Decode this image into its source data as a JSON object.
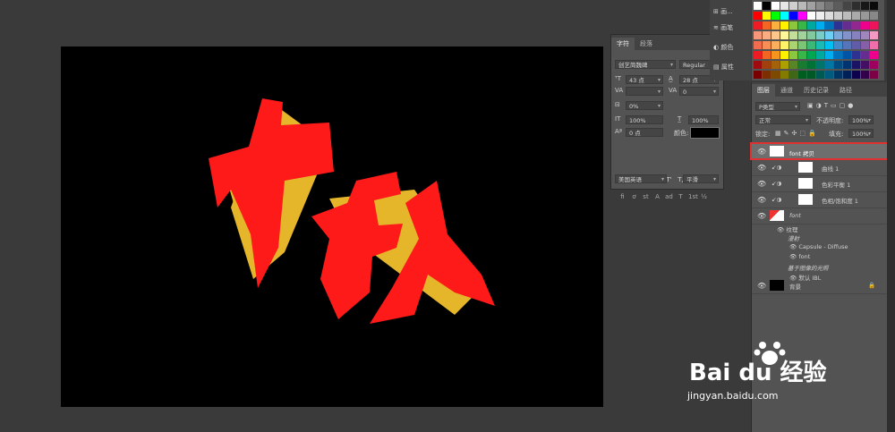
{
  "canvas": {
    "artwork_text": "中秋",
    "colors": {
      "background": "#000000",
      "front": "#ff1a1a",
      "extrude": "#e5b62a"
    }
  },
  "char_panel": {
    "tabs": [
      "字符",
      "段落"
    ],
    "font_family": "创艺简魏碑",
    "font_style": "Regular",
    "font_size": "43 点",
    "leading": "28 点",
    "tracking": "0",
    "scale_pct": "0%",
    "vert_scale": "100%",
    "horiz_scale": "100%",
    "baseline": "0 点",
    "color_label": "颜色:",
    "language": "美国英语",
    "antialias": "平滑",
    "style_buttons": [
      "T",
      "T",
      "TT",
      "Tт",
      "T'",
      "T,",
      "T",
      "T"
    ],
    "ot_buttons": [
      "fi",
      "ơ",
      "st",
      "A",
      "ad",
      "T",
      "1st",
      "½"
    ]
  },
  "dock": {
    "items": [
      "画...",
      "画笔",
      "颜色",
      "属性"
    ]
  },
  "swatches": {
    "rows": [
      [
        "#ffffff",
        "#000000",
        "#ffffff",
        "#e6e6e6",
        "#cfcfcf",
        "#b8b8b8",
        "#a1a1a1",
        "#8a8a8a",
        "#737373",
        "#5c5c5c",
        "#454545",
        "#2e2e2e",
        "#171717",
        "#0a0a0a"
      ],
      [
        "#ff0000",
        "#ffff00",
        "#00ff00",
        "#00ffff",
        "#0000ff",
        "#ff00ff",
        "#ffffff",
        "#eeeeee",
        "#dddddd",
        "#cccccc",
        "#bbbbbb",
        "#aaaaaa",
        "#999999",
        "#888888"
      ],
      [
        "#ee1c24",
        "#f26522",
        "#fbaf3f",
        "#fff200",
        "#8dc63f",
        "#39b54a",
        "#00a99d",
        "#00aeef",
        "#0072bc",
        "#2e3192",
        "#662d91",
        "#92278f",
        "#ec008c",
        "#ed145b"
      ],
      [
        "#f7977a",
        "#f9ad81",
        "#fdc68a",
        "#fff79a",
        "#c4df9b",
        "#a3d39c",
        "#82ca9d",
        "#7accc8",
        "#6dcff6",
        "#7da7d9",
        "#8393ca",
        "#8781bd",
        "#a186be",
        "#f49ac2"
      ],
      [
        "#f26c4f",
        "#f68e55",
        "#fbaf5c",
        "#fff467",
        "#acd372",
        "#7cc576",
        "#3bb878",
        "#1abbb4",
        "#00bff3",
        "#438ccb",
        "#5574b9",
        "#605ca8",
        "#855fa8",
        "#f06ea9"
      ],
      [
        "#ed1c24",
        "#f26522",
        "#f7941d",
        "#fff200",
        "#8dc63f",
        "#39b54a",
        "#00a651",
        "#00a99d",
        "#00aeef",
        "#0072bc",
        "#0054a6",
        "#2e3192",
        "#662d91",
        "#ec008c"
      ],
      [
        "#9e0b0f",
        "#a0410d",
        "#a3620a",
        "#aba000",
        "#598527",
        "#197b30",
        "#007236",
        "#00746b",
        "#0076a3",
        "#004b80",
        "#003471",
        "#1b1464",
        "#440e62",
        "#9e005d"
      ],
      [
        "#790000",
        "#7b2e00",
        "#7d4900",
        "#827b00",
        "#406618",
        "#005e20",
        "#005826",
        "#005952",
        "#005b7f",
        "#003663",
        "#002157",
        "#0d004c",
        "#32004b",
        "#7b0046"
      ]
    ]
  },
  "layers": {
    "tabs": [
      "图层",
      "通道",
      "历史记录",
      "路径"
    ],
    "filter_label": "P类型",
    "blend_mode": "正常",
    "opacity_label": "不透明度:",
    "opacity_value": "100%",
    "lock_label": "锁定:",
    "fill_label": "填充:",
    "fill_value": "100%",
    "rows": [
      {
        "name": "font 拷贝",
        "selected": true
      },
      {
        "name": "曲线 1"
      },
      {
        "name": "色彩平衡 1"
      },
      {
        "name": "色相/饱和度 1"
      },
      {
        "name": "font"
      },
      {
        "name": "纹理"
      },
      {
        "name": "漫射"
      },
      {
        "name": "Capsule - Diffuse"
      },
      {
        "name": "font"
      },
      {
        "name": "基于图像的光照"
      },
      {
        "name": "默认 IBL"
      },
      {
        "name": "背景"
      }
    ]
  },
  "watermark": {
    "brand": "Bai du 经验",
    "url": "jingyan.baidu.com"
  }
}
